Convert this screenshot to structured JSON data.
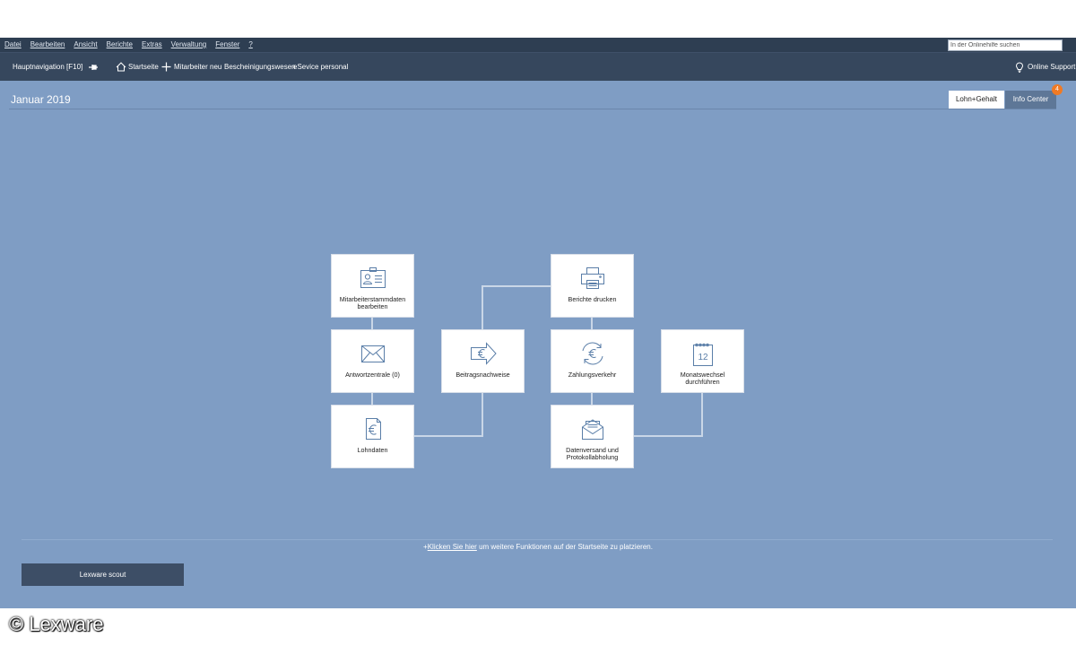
{
  "menu": {
    "items": [
      "Datei",
      "Bearbeiten",
      "Ansicht",
      "Berichte",
      "Extras",
      "Verwaltung",
      "Fenster",
      "?"
    ],
    "help_search_placeholder": "In der Onlinehilfe suchen"
  },
  "toolbar": {
    "hauptnavigation": "Hauptnavigation [F10]",
    "startseite": "Startseite",
    "mitarbeiter_neu": "Mitarbeiter neu",
    "bescheinigungswesen": "Bescheinigungswesen",
    "eservice": "eSevice personal",
    "online_support": "Online Support"
  },
  "page": {
    "period": "Januar 2019",
    "tabs": [
      {
        "label": "Lohn+Gehalt",
        "active": true
      },
      {
        "label": "Info Center",
        "active": false
      }
    ],
    "info_badge": "4"
  },
  "tiles": [
    {
      "id": "mitarbeiterstammdaten",
      "label": "Mitarbeiterstammdaten bearbeiten",
      "icon": "id-card-icon"
    },
    {
      "id": "antwortzentrale",
      "label": "Antwortzentrale (0)",
      "icon": "envelope-icon"
    },
    {
      "id": "lohndaten",
      "label": "Lohndaten",
      "icon": "euro-document-icon"
    },
    {
      "id": "beitragsnachweise",
      "label": "Beitragsnachweise",
      "icon": "euro-arrow-icon"
    },
    {
      "id": "berichte",
      "label": "Berichte drucken",
      "icon": "printer-icon"
    },
    {
      "id": "zahlungsverkehr",
      "label": "Zahlungsverkehr",
      "icon": "euro-cycle-icon"
    },
    {
      "id": "datenversand",
      "label": "Datenversand und Protokollabholung",
      "icon": "mail-send-icon"
    },
    {
      "id": "monatswechsel",
      "label": "Monatswechsel durchführen",
      "icon": "calendar-icon",
      "calendar_day": "12"
    }
  ],
  "bottom": {
    "hint_link": "Klicken Sie hier",
    "hint_rest": " um weitere Funktionen auf der Startseite zu platzieren.",
    "scout_button": "Lexware scout"
  },
  "watermark": "© Lexware",
  "colors": {
    "workspace": "#7f9dc4",
    "menubar": "#2e3e52",
    "toolbar": "#36475d",
    "icon_stroke": "#5a7ea8",
    "badge": "#f07a24"
  }
}
